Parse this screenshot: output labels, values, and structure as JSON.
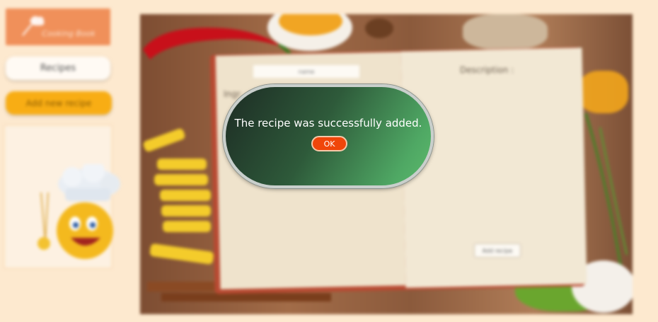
{
  "sidebar": {
    "logo_text": "Cooking Book",
    "recipes_label": "Recipes",
    "add_new_recipe_label": "Add new recipe"
  },
  "book": {
    "name_placeholder": "name",
    "ingredients_label": "Ingr",
    "description_label": "Description :",
    "add_recipe_label": "Add recipe"
  },
  "dialog": {
    "message": "The recipe was successfully added.",
    "ok_label": "OK"
  },
  "colors": {
    "background": "#fde9cf",
    "logo": "#f0905a",
    "add_button": "#f8ad14",
    "ok_button": "#f0460a",
    "dialog_gradient_start": "#1d2c24",
    "dialog_gradient_end": "#5cba6c"
  }
}
